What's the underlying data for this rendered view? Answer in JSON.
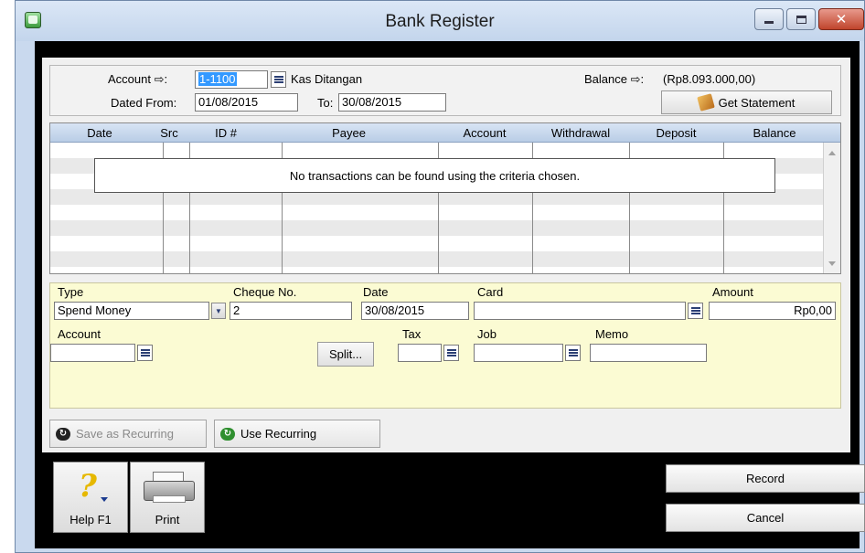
{
  "window": {
    "title": "Bank Register"
  },
  "header": {
    "account_label": "Account ⇨:",
    "account_id": "1-1100",
    "account_name": "Kas Ditangan",
    "balance_label": "Balance ⇨:",
    "balance_value": "(Rp8.093.000,00)",
    "dated_from_label": "Dated From:",
    "dated_from_value": "01/08/2015",
    "to_label": "To:",
    "to_value": "30/08/2015",
    "get_statement_label": "Get Statement"
  },
  "grid": {
    "columns": [
      "Date",
      "Src",
      "ID #",
      "Payee",
      "Account",
      "Withdrawal",
      "Deposit",
      "Balance"
    ],
    "empty_message": "No transactions can be found using the criteria chosen."
  },
  "entry": {
    "type_label": "Type",
    "type_value": "Spend Money",
    "cheque_label": "Cheque No.",
    "cheque_value": "2",
    "date_label": "Date",
    "date_value": "30/08/2015",
    "card_label": "Card",
    "card_value": "",
    "amount_label": "Amount",
    "amount_value": "Rp0,00",
    "account_label": "Account",
    "account_value": "",
    "split_label": "Split...",
    "tax_label": "Tax",
    "tax_value": "",
    "job_label": "Job",
    "job_value": "",
    "memo_label": "Memo",
    "memo_value": ""
  },
  "recurring": {
    "save_label": "Save as Recurring",
    "use_label": "Use Recurring"
  },
  "toolbar": {
    "help_label": "Help F1",
    "print_label": "Print"
  },
  "actions": {
    "record_label": "Record",
    "cancel_label": "Cancel"
  },
  "colors": {
    "entry_background": "#fbfbd3",
    "selection": "#3399ff",
    "close_button": "#c0442c"
  }
}
